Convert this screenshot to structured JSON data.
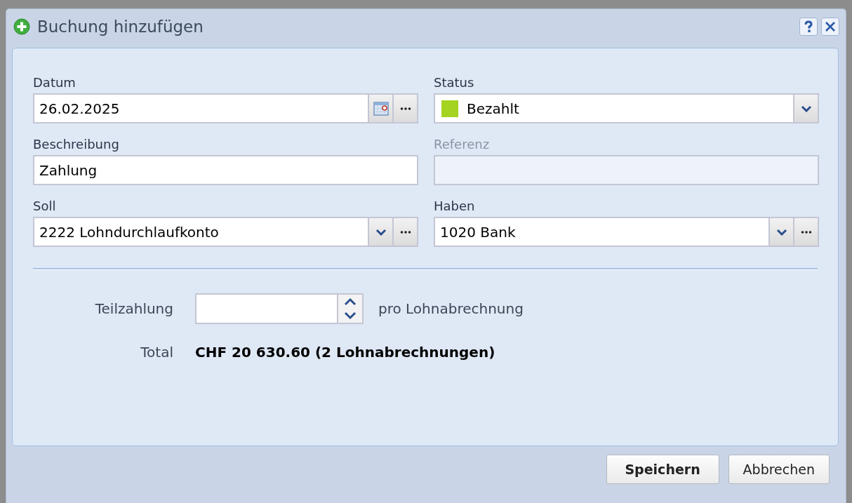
{
  "dialog": {
    "title": "Buchung hinzufügen"
  },
  "fields": [
    {
      "label": "Datum",
      "value": "26.02.2025",
      "kind": "date",
      "disabled": false
    },
    {
      "label": "Status",
      "value": "Bezahlt",
      "kind": "status",
      "color": "#a4d321",
      "disabled": false
    },
    {
      "label": "Beschreibung",
      "value": "Zahlung",
      "kind": "text",
      "disabled": false
    },
    {
      "label": "Referenz",
      "kind": "text",
      "disabled": true
    },
    {
      "label": "Soll",
      "value": "2222 Lohndurchlaufkonto",
      "kind": "account",
      "disabled": false
    },
    {
      "label": "Haben",
      "value": "1020 Bank",
      "kind": "account",
      "disabled": false
    }
  ],
  "partial_payment": {
    "label": "Teilzahlung",
    "suffix": "pro Lohnabrechnung"
  },
  "total": {
    "label": "Total",
    "value": "CHF 20 630.60 (2 Lohnabrechnungen)"
  },
  "buttons": [
    {
      "label": "Speichern",
      "kind": "primary"
    },
    {
      "label": "Abbrechen",
      "kind": "secondary"
    }
  ]
}
